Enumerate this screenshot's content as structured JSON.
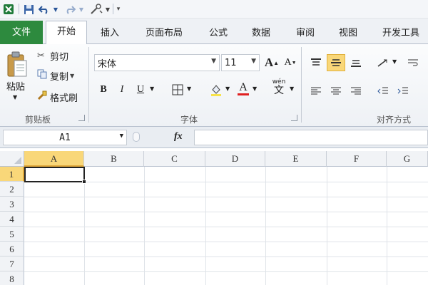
{
  "quick_access": {
    "icons": [
      "excel-logo-icon",
      "save-icon",
      "undo-icon",
      "redo-icon",
      "customize-icon"
    ]
  },
  "tabs": {
    "file": "文件",
    "home": "开始",
    "insert": "插入",
    "page_layout": "页面布局",
    "formulas": "公式",
    "data": "数据",
    "review": "审阅",
    "view": "视图",
    "developer": "开发工具"
  },
  "ribbon": {
    "clipboard": {
      "paste": "粘贴",
      "cut": "剪切",
      "copy": "复制",
      "format_painter": "格式刷",
      "group_label": "剪贴板"
    },
    "font": {
      "font_name": "宋体",
      "font_size": "11",
      "bold": "B",
      "italic": "I",
      "underline": "U",
      "font_color_letter": "A",
      "phonetic": "wén",
      "group_label": "字体"
    },
    "alignment": {
      "group_label": "对齐方式"
    }
  },
  "formula_bar": {
    "name_box": "A1",
    "fx": "fx",
    "formula_value": ""
  },
  "sheet": {
    "columns": [
      "A",
      "B",
      "C",
      "D",
      "E",
      "F",
      "G"
    ],
    "rows": [
      "1",
      "2",
      "3",
      "4",
      "5",
      "6",
      "7",
      "8"
    ],
    "selected_cell": "A1"
  },
  "colors": {
    "file_tab": "#2d8a3e",
    "font_color_underline": "#e02020",
    "selected_align": "#f9d779"
  }
}
